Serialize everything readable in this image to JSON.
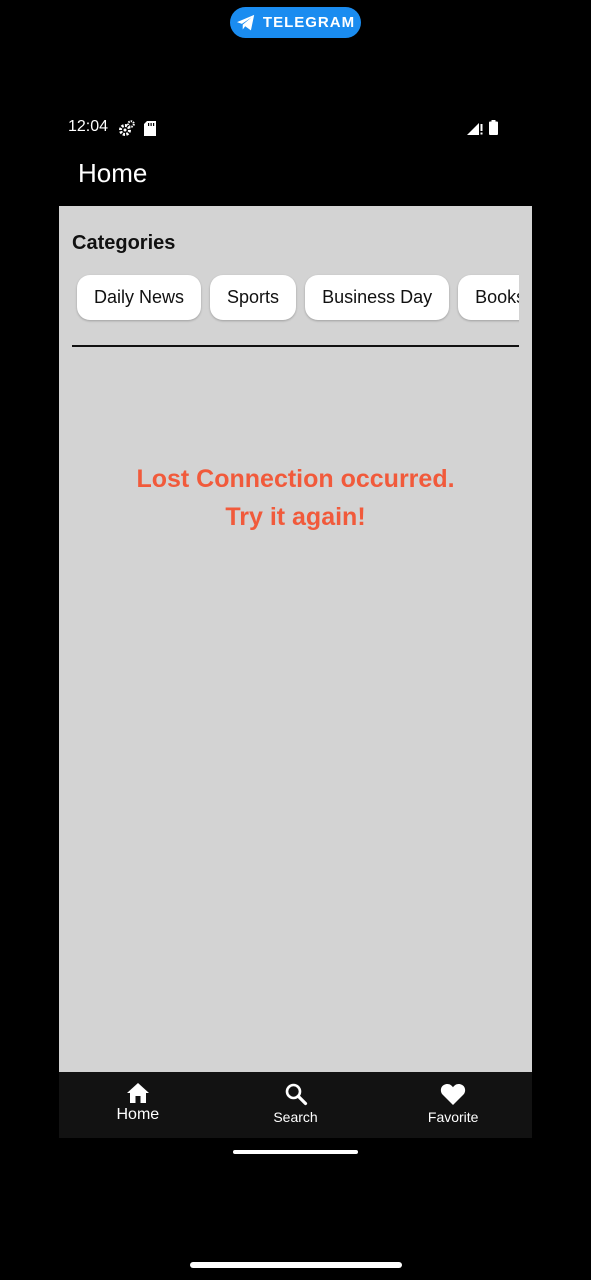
{
  "overlay": {
    "badge_label": "TELEGRAM"
  },
  "status_bar": {
    "time": "12:04"
  },
  "app_bar": {
    "title": "Home"
  },
  "categories": {
    "heading": "Categories",
    "chips": [
      "Daily News",
      "Sports",
      "Business Day",
      "Books"
    ]
  },
  "error": {
    "line1": "Lost Connection occurred.",
    "line2": "Try it again!"
  },
  "bottom_nav": {
    "items": [
      {
        "label": "Home",
        "icon": "home-icon",
        "active": true
      },
      {
        "label": "Search",
        "icon": "search-icon",
        "active": false
      },
      {
        "label": "Favorite",
        "icon": "heart-icon",
        "active": false
      }
    ]
  },
  "colors": {
    "accent": "#f15a3b",
    "telegram": "#1a8cf0",
    "content_bg": "#d3d3d3",
    "nav_bg": "#121212"
  }
}
